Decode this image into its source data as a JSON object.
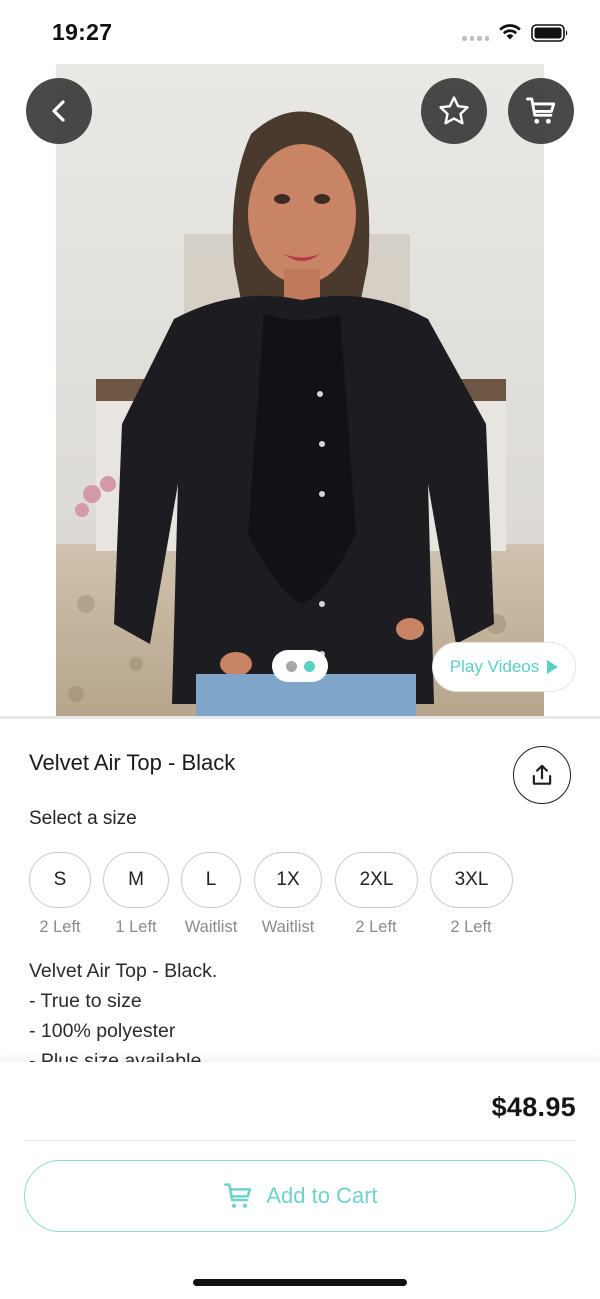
{
  "status_bar": {
    "time": "19:27"
  },
  "product": {
    "title": "Velvet Air Top - Black",
    "image_pager": {
      "count": 2,
      "active_index": 1
    },
    "play_videos_label": "Play Videos",
    "size_heading": "Select a size",
    "sizes": [
      {
        "label": "S",
        "stock": "2 Left"
      },
      {
        "label": "M",
        "stock": "1 Left"
      },
      {
        "label": "L",
        "stock": "Waitlist"
      },
      {
        "label": "1X",
        "stock": "Waitlist"
      },
      {
        "label": "2XL",
        "stock": "2 Left"
      },
      {
        "label": "3XL",
        "stock": "2 Left"
      }
    ],
    "description": [
      "Velvet Air Top - Black.",
      "- True to size",
      "- 100% polyester",
      "- Plus size available"
    ],
    "price": "$48.95"
  },
  "actions": {
    "add_to_cart_label": "Add to Cart"
  },
  "icons": {
    "back": "chevron-left-icon",
    "favorite": "star-icon",
    "cart": "cart-icon",
    "share": "share-icon",
    "play": "play-icon"
  },
  "colors": {
    "accent": "#5ccfc4",
    "dark_button": "#3a3a3a"
  }
}
